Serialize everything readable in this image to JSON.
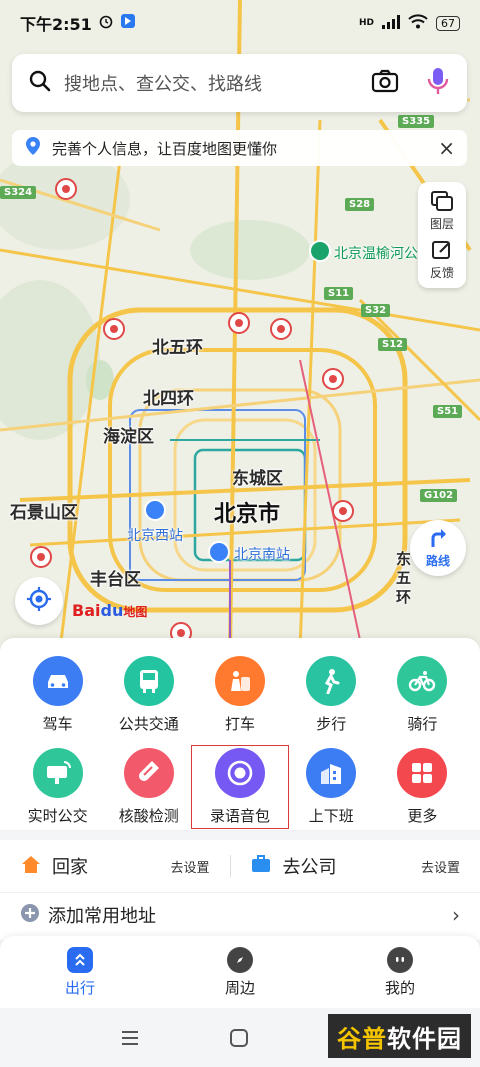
{
  "status_bar": {
    "time": "下午2:51",
    "network": "HD",
    "battery": "67"
  },
  "search": {
    "placeholder": "搜地点、查公交、找路线"
  },
  "notice": {
    "text": "完善个人信息，让百度地图更懂你"
  },
  "map_controls": {
    "layers_label": "图层",
    "feedback_label": "反馈",
    "route_label": "路线"
  },
  "map": {
    "labels": {
      "bei_wu_huan": "北五环",
      "bei_si_huan": "北四环",
      "haidian": "海淀区",
      "dongcheng": "东城区",
      "beijing": "北京市",
      "shijingshan": "石景山区",
      "fengtai": "丰台区",
      "beijing_west": "北京西站",
      "beijing_south": "北京南站",
      "wenyu_river": "北京温榆河公",
      "dong_wu_huan": "东\n五\n环"
    },
    "shields": {
      "s335": "S335",
      "s324": "S324",
      "s28": "S28",
      "s11": "S11",
      "s32": "S32",
      "s12": "S12",
      "s51": "S51",
      "g102": "G102"
    },
    "logo": {
      "bai": "Bai",
      "du": "du",
      "map": "地图"
    }
  },
  "services": [
    {
      "label": "驾车",
      "color": "#3d7df4",
      "icon": "car-icon"
    },
    {
      "label": "公共交通",
      "color": "#25c4a0",
      "icon": "bus-icon"
    },
    {
      "label": "打车",
      "color": "#ff7a2f",
      "icon": "taxi-icon"
    },
    {
      "label": "步行",
      "color": "#29c3a2",
      "icon": "walk-icon"
    },
    {
      "label": "骑行",
      "color": "#2fc79a",
      "icon": "bike-icon"
    },
    {
      "label": "实时公交",
      "color": "#2fc79a",
      "icon": "realtime-bus-icon"
    },
    {
      "label": "核酸检测",
      "color": "#f25a6b",
      "icon": "test-tube-icon"
    },
    {
      "label": "录语音包",
      "color": "#7559f2",
      "icon": "record-icon"
    },
    {
      "label": "上下班",
      "color": "#3d7df4",
      "icon": "building-icon"
    },
    {
      "label": "更多",
      "color": "#f2484e",
      "icon": "grid-icon"
    }
  ],
  "addresses": {
    "home_label": "回家",
    "home_action": "去设置",
    "work_label": "去公司",
    "work_action": "去设置",
    "add_label": "添加常用地址"
  },
  "tabs": [
    {
      "label": "出行",
      "active": true
    },
    {
      "label": "周边",
      "active": false
    },
    {
      "label": "我的",
      "active": false
    }
  ],
  "watermark": {
    "part1": "谷普",
    "part2": "软件园"
  }
}
